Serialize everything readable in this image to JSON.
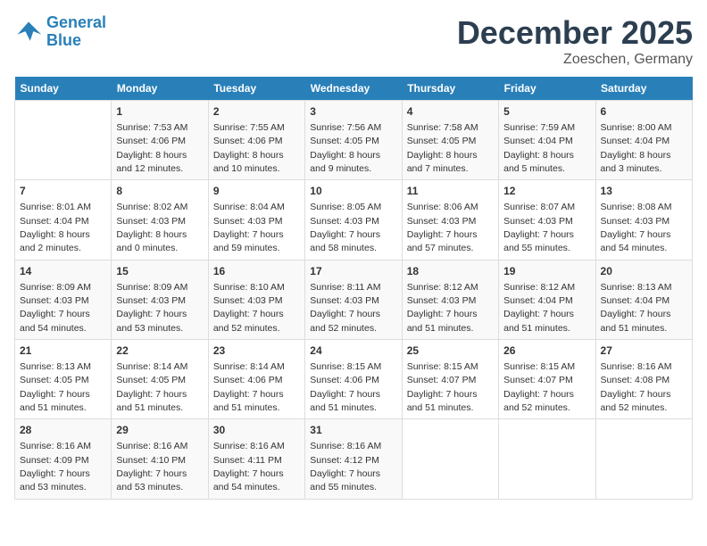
{
  "header": {
    "logo_line1": "General",
    "logo_line2": "Blue",
    "month": "December 2025",
    "location": "Zoeschen, Germany"
  },
  "weekdays": [
    "Sunday",
    "Monday",
    "Tuesday",
    "Wednesday",
    "Thursday",
    "Friday",
    "Saturday"
  ],
  "weeks": [
    [
      {
        "day": "",
        "sunrise": "",
        "sunset": "",
        "daylight": ""
      },
      {
        "day": "1",
        "sunrise": "Sunrise: 7:53 AM",
        "sunset": "Sunset: 4:06 PM",
        "daylight": "Daylight: 8 hours and 12 minutes."
      },
      {
        "day": "2",
        "sunrise": "Sunrise: 7:55 AM",
        "sunset": "Sunset: 4:06 PM",
        "daylight": "Daylight: 8 hours and 10 minutes."
      },
      {
        "day": "3",
        "sunrise": "Sunrise: 7:56 AM",
        "sunset": "Sunset: 4:05 PM",
        "daylight": "Daylight: 8 hours and 9 minutes."
      },
      {
        "day": "4",
        "sunrise": "Sunrise: 7:58 AM",
        "sunset": "Sunset: 4:05 PM",
        "daylight": "Daylight: 8 hours and 7 minutes."
      },
      {
        "day": "5",
        "sunrise": "Sunrise: 7:59 AM",
        "sunset": "Sunset: 4:04 PM",
        "daylight": "Daylight: 8 hours and 5 minutes."
      },
      {
        "day": "6",
        "sunrise": "Sunrise: 8:00 AM",
        "sunset": "Sunset: 4:04 PM",
        "daylight": "Daylight: 8 hours and 3 minutes."
      }
    ],
    [
      {
        "day": "7",
        "sunrise": "Sunrise: 8:01 AM",
        "sunset": "Sunset: 4:04 PM",
        "daylight": "Daylight: 8 hours and 2 minutes."
      },
      {
        "day": "8",
        "sunrise": "Sunrise: 8:02 AM",
        "sunset": "Sunset: 4:03 PM",
        "daylight": "Daylight: 8 hours and 0 minutes."
      },
      {
        "day": "9",
        "sunrise": "Sunrise: 8:04 AM",
        "sunset": "Sunset: 4:03 PM",
        "daylight": "Daylight: 7 hours and 59 minutes."
      },
      {
        "day": "10",
        "sunrise": "Sunrise: 8:05 AM",
        "sunset": "Sunset: 4:03 PM",
        "daylight": "Daylight: 7 hours and 58 minutes."
      },
      {
        "day": "11",
        "sunrise": "Sunrise: 8:06 AM",
        "sunset": "Sunset: 4:03 PM",
        "daylight": "Daylight: 7 hours and 57 minutes."
      },
      {
        "day": "12",
        "sunrise": "Sunrise: 8:07 AM",
        "sunset": "Sunset: 4:03 PM",
        "daylight": "Daylight: 7 hours and 55 minutes."
      },
      {
        "day": "13",
        "sunrise": "Sunrise: 8:08 AM",
        "sunset": "Sunset: 4:03 PM",
        "daylight": "Daylight: 7 hours and 54 minutes."
      }
    ],
    [
      {
        "day": "14",
        "sunrise": "Sunrise: 8:09 AM",
        "sunset": "Sunset: 4:03 PM",
        "daylight": "Daylight: 7 hours and 54 minutes."
      },
      {
        "day": "15",
        "sunrise": "Sunrise: 8:09 AM",
        "sunset": "Sunset: 4:03 PM",
        "daylight": "Daylight: 7 hours and 53 minutes."
      },
      {
        "day": "16",
        "sunrise": "Sunrise: 8:10 AM",
        "sunset": "Sunset: 4:03 PM",
        "daylight": "Daylight: 7 hours and 52 minutes."
      },
      {
        "day": "17",
        "sunrise": "Sunrise: 8:11 AM",
        "sunset": "Sunset: 4:03 PM",
        "daylight": "Daylight: 7 hours and 52 minutes."
      },
      {
        "day": "18",
        "sunrise": "Sunrise: 8:12 AM",
        "sunset": "Sunset: 4:03 PM",
        "daylight": "Daylight: 7 hours and 51 minutes."
      },
      {
        "day": "19",
        "sunrise": "Sunrise: 8:12 AM",
        "sunset": "Sunset: 4:04 PM",
        "daylight": "Daylight: 7 hours and 51 minutes."
      },
      {
        "day": "20",
        "sunrise": "Sunrise: 8:13 AM",
        "sunset": "Sunset: 4:04 PM",
        "daylight": "Daylight: 7 hours and 51 minutes."
      }
    ],
    [
      {
        "day": "21",
        "sunrise": "Sunrise: 8:13 AM",
        "sunset": "Sunset: 4:05 PM",
        "daylight": "Daylight: 7 hours and 51 minutes."
      },
      {
        "day": "22",
        "sunrise": "Sunrise: 8:14 AM",
        "sunset": "Sunset: 4:05 PM",
        "daylight": "Daylight: 7 hours and 51 minutes."
      },
      {
        "day": "23",
        "sunrise": "Sunrise: 8:14 AM",
        "sunset": "Sunset: 4:06 PM",
        "daylight": "Daylight: 7 hours and 51 minutes."
      },
      {
        "day": "24",
        "sunrise": "Sunrise: 8:15 AM",
        "sunset": "Sunset: 4:06 PM",
        "daylight": "Daylight: 7 hours and 51 minutes."
      },
      {
        "day": "25",
        "sunrise": "Sunrise: 8:15 AM",
        "sunset": "Sunset: 4:07 PM",
        "daylight": "Daylight: 7 hours and 51 minutes."
      },
      {
        "day": "26",
        "sunrise": "Sunrise: 8:15 AM",
        "sunset": "Sunset: 4:07 PM",
        "daylight": "Daylight: 7 hours and 52 minutes."
      },
      {
        "day": "27",
        "sunrise": "Sunrise: 8:16 AM",
        "sunset": "Sunset: 4:08 PM",
        "daylight": "Daylight: 7 hours and 52 minutes."
      }
    ],
    [
      {
        "day": "28",
        "sunrise": "Sunrise: 8:16 AM",
        "sunset": "Sunset: 4:09 PM",
        "daylight": "Daylight: 7 hours and 53 minutes."
      },
      {
        "day": "29",
        "sunrise": "Sunrise: 8:16 AM",
        "sunset": "Sunset: 4:10 PM",
        "daylight": "Daylight: 7 hours and 53 minutes."
      },
      {
        "day": "30",
        "sunrise": "Sunrise: 8:16 AM",
        "sunset": "Sunset: 4:11 PM",
        "daylight": "Daylight: 7 hours and 54 minutes."
      },
      {
        "day": "31",
        "sunrise": "Sunrise: 8:16 AM",
        "sunset": "Sunset: 4:12 PM",
        "daylight": "Daylight: 7 hours and 55 minutes."
      },
      {
        "day": "",
        "sunrise": "",
        "sunset": "",
        "daylight": ""
      },
      {
        "day": "",
        "sunrise": "",
        "sunset": "",
        "daylight": ""
      },
      {
        "day": "",
        "sunrise": "",
        "sunset": "",
        "daylight": ""
      }
    ]
  ]
}
